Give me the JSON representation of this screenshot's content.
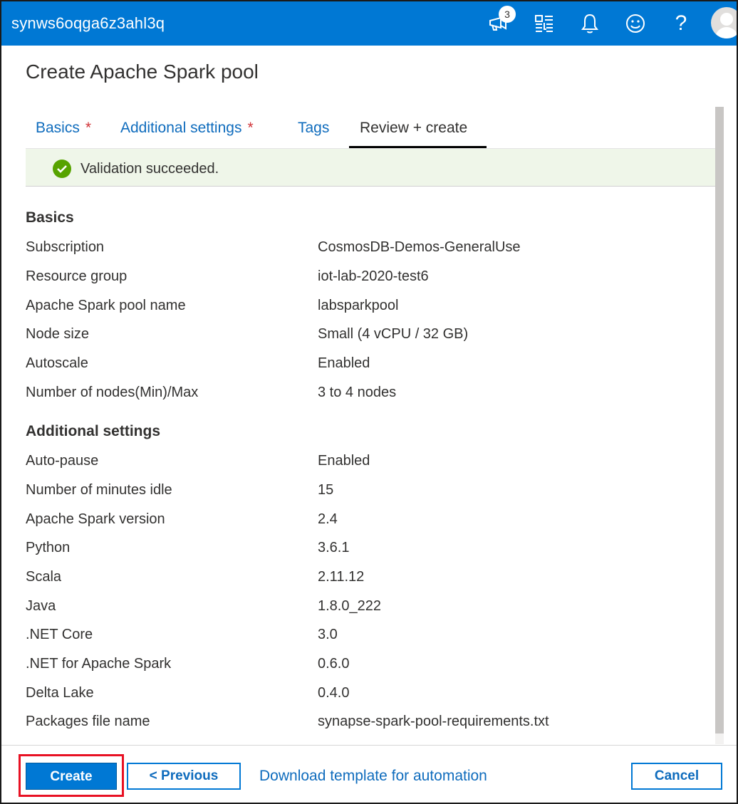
{
  "header": {
    "app_title": "synws6oqga6z3ahl3q",
    "notification_count": "3",
    "icons": [
      "megaphone-icon",
      "directories-icon",
      "bell-icon",
      "smiley-icon",
      "question-mark-icon",
      "avatar-icon"
    ],
    "help_glyph": "?",
    "accent_color": "#0078d4"
  },
  "page": {
    "title": "Create Apache Spark pool"
  },
  "tabs": [
    {
      "label": "Basics",
      "required": "*"
    },
    {
      "label": "Additional settings",
      "required": "*"
    },
    {
      "label": "Tags"
    },
    {
      "label": "Review + create",
      "selected": true
    }
  ],
  "validation": {
    "message": "Validation succeeded.",
    "status_color": "#57a300"
  },
  "basics": {
    "title": "Basics",
    "rows": [
      {
        "label": "Subscription",
        "value": "CosmosDB-Demos-GeneralUse"
      },
      {
        "label": "Resource group",
        "value": "iot-lab-2020-test6"
      },
      {
        "label": "Apache Spark pool name",
        "value": "labsparkpool"
      },
      {
        "label": "Node size",
        "value": "Small (4 vCPU / 32 GB)"
      },
      {
        "label": "Autoscale",
        "value": "Enabled"
      },
      {
        "label": "Number of nodes(Min)/Max",
        "value": "3 to 4 nodes"
      }
    ]
  },
  "additional": {
    "title": "Additional settings",
    "rows": [
      {
        "label": "Auto-pause",
        "value": "Enabled"
      },
      {
        "label": "Number of minutes idle",
        "value": "15"
      },
      {
        "label": "Apache Spark version",
        "value": "2.4"
      },
      {
        "label": "Python",
        "value": "3.6.1"
      },
      {
        "label": "Scala",
        "value": "2.11.12"
      },
      {
        "label": "Java",
        "value": "1.8.0_222"
      },
      {
        "label": ".NET Core",
        "value": "3.0"
      },
      {
        "label": ".NET for Apache Spark",
        "value": "0.6.0"
      },
      {
        "label": "Delta Lake",
        "value": "0.4.0"
      },
      {
        "label": "Packages file name",
        "value": "synapse-spark-pool-requirements.txt"
      }
    ]
  },
  "footer": {
    "create_label": "Create",
    "previous_label": "< Previous",
    "download_label": "Download template for automation",
    "cancel_label": "Cancel"
  }
}
